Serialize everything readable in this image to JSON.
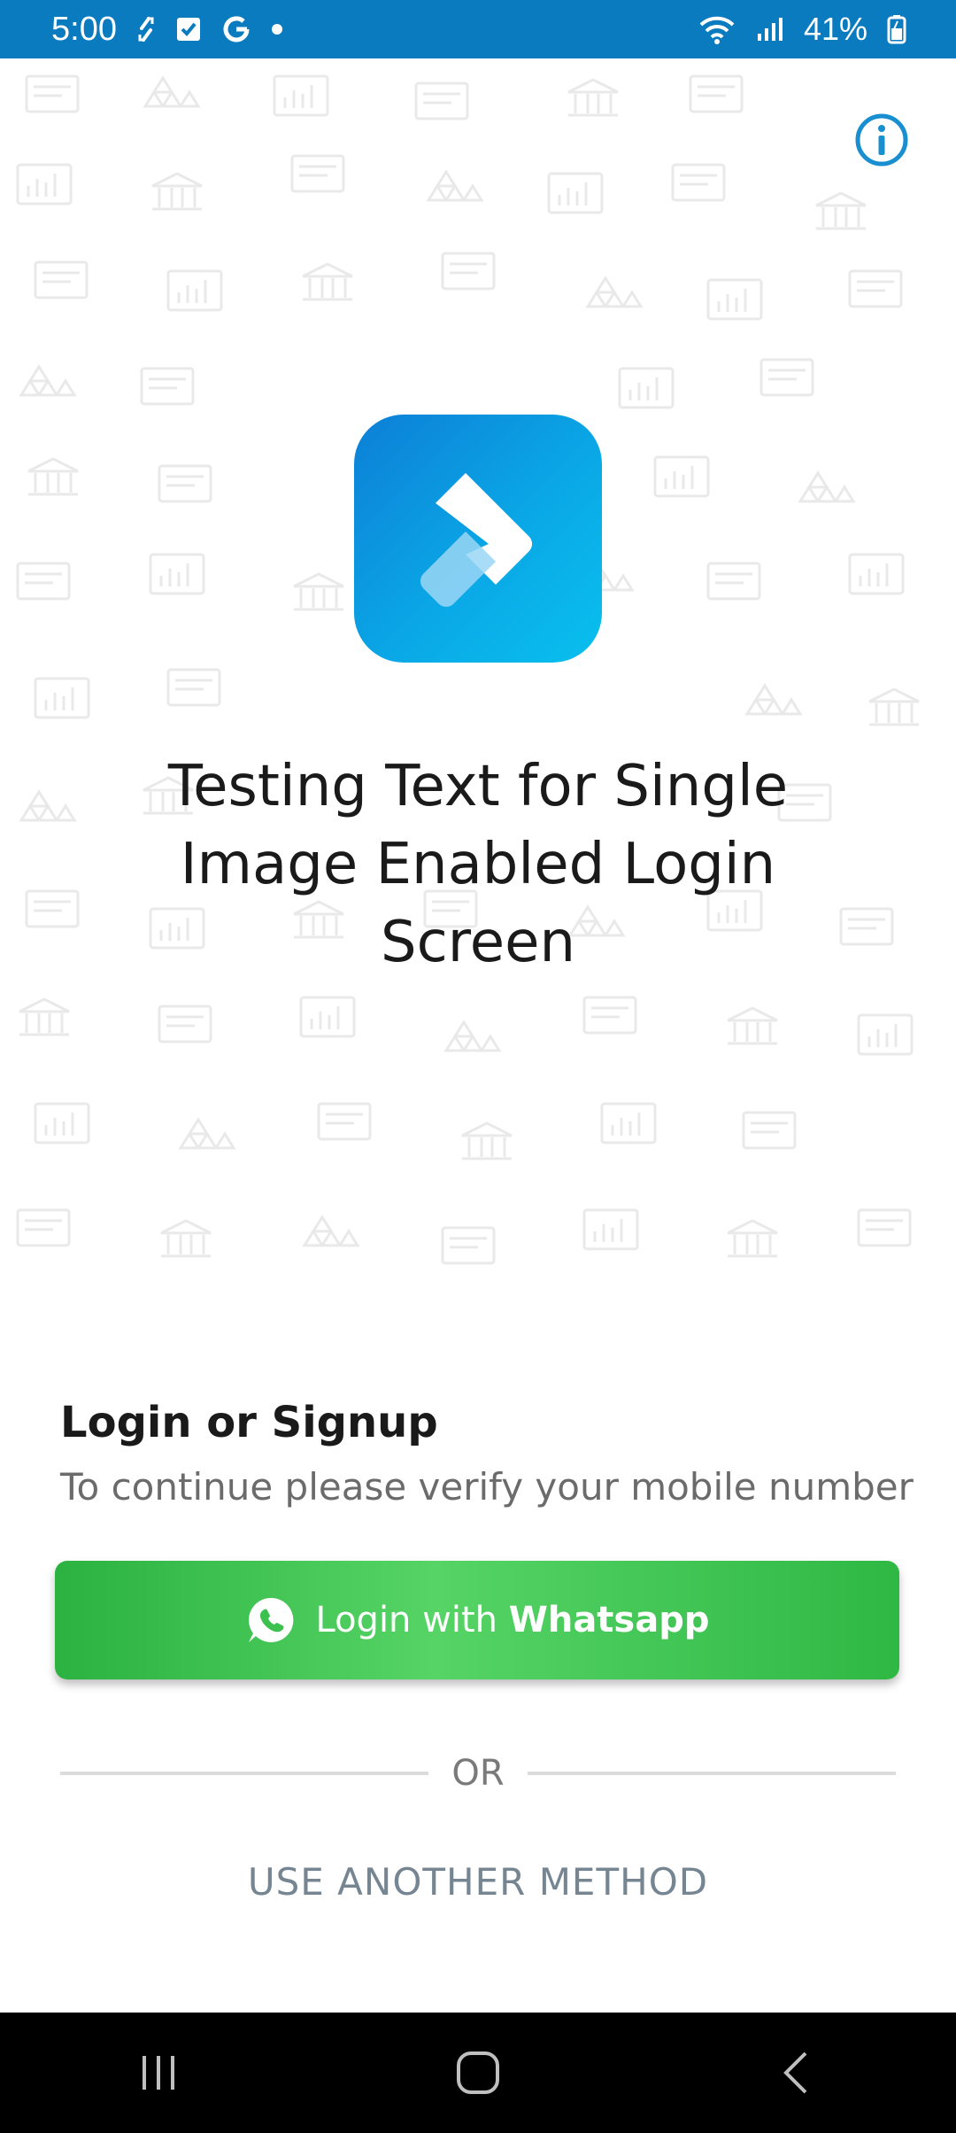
{
  "status_bar": {
    "time": "5:00",
    "battery": "41%",
    "icons": [
      "sync-icon",
      "checkbox-icon",
      "google-icon",
      "dot-icon",
      "wifi-icon",
      "signal-icon",
      "battery-icon"
    ]
  },
  "hero": {
    "title": "Testing Text for Single Image Enabled Login Screen",
    "info_icon": "info-icon",
    "logo": "app-logo"
  },
  "sheet": {
    "title": "Login or Signup",
    "subtitle": "To continue please verify your mobile number",
    "whatsapp_button": {
      "prefix": "Login with",
      "bold": "Whatsapp",
      "icon": "whatsapp-icon"
    },
    "or_label": "OR",
    "another_method": "USE ANOTHER METHOD"
  },
  "nav_bar": {
    "buttons": [
      "recents-icon",
      "home-icon",
      "back-icon"
    ]
  },
  "colors": {
    "status_bar": "#0a7bbf",
    "whatsapp_green": "#3cc04e",
    "info_blue": "#1a8fd0",
    "muted_text": "#758692"
  }
}
